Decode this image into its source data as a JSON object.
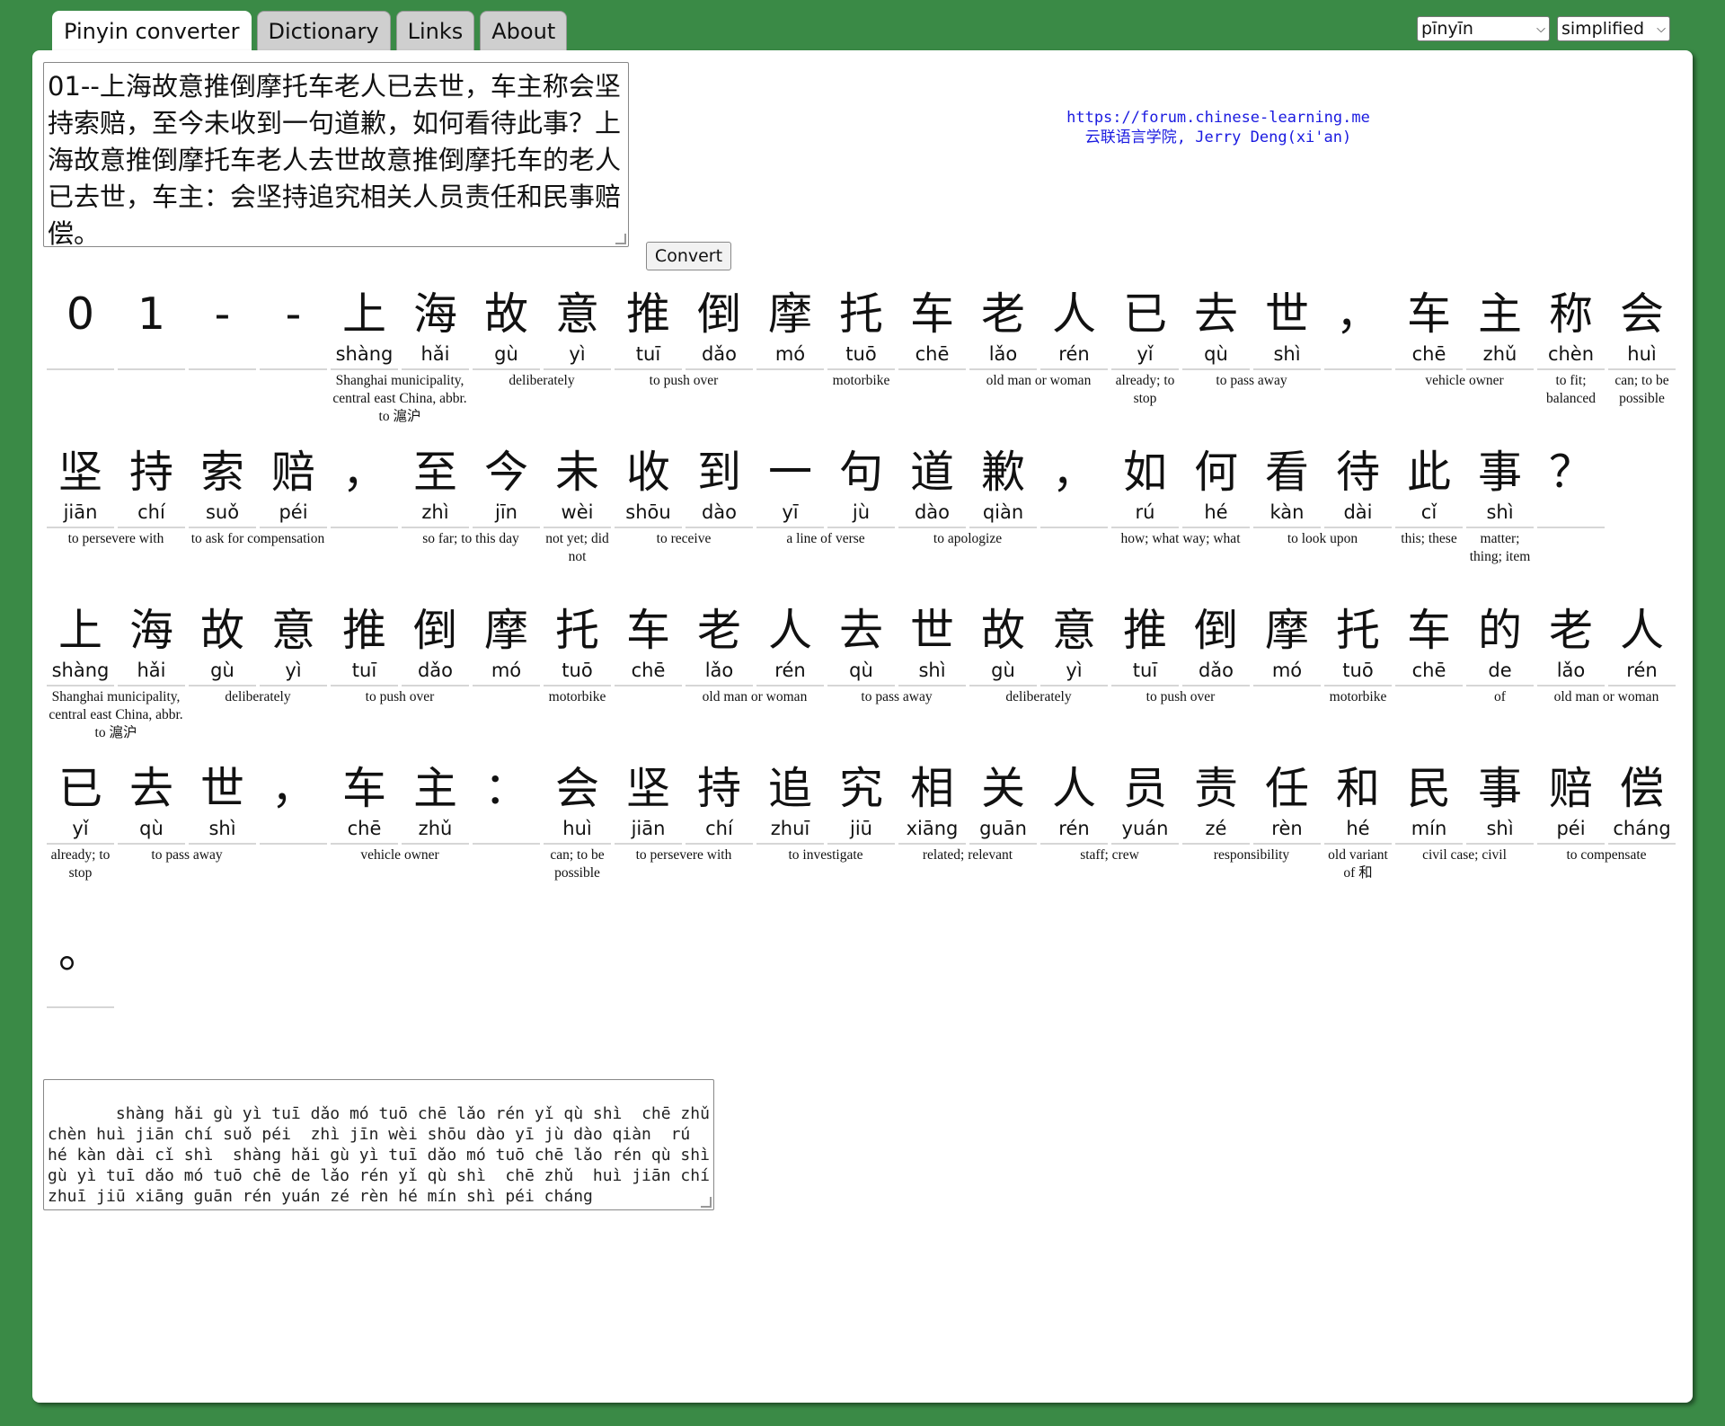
{
  "tabs": [
    "Pinyin converter",
    "Dictionary",
    "Links",
    "About"
  ],
  "selects": {
    "romanization": "pīnyīn",
    "script": "simplified"
  },
  "input_text": "01--上海故意推倒摩托车老人已去世，车主称会坚持索赔，至今未收到一句道歉，如何看待此事？上海故意推倒摩托车老人去世故意推倒摩托车的老人已去世，车主：会坚持追究相关人员责任和民事赔偿。",
  "convert_label": "Convert",
  "credit": {
    "line1": "https://forum.chinese-learning.me",
    "line2": "云联语言学院, Jerry Deng(xi'an)"
  },
  "lines": [
    {
      "chars": [
        {
          "h": "0",
          "p": ""
        },
        {
          "h": "1",
          "p": ""
        },
        {
          "h": "-",
          "p": ""
        },
        {
          "h": "-",
          "p": ""
        },
        {
          "h": "上",
          "p": "shàng"
        },
        {
          "h": "海",
          "p": "hǎi"
        },
        {
          "h": "故",
          "p": "gù"
        },
        {
          "h": "意",
          "p": "yì"
        },
        {
          "h": "推",
          "p": "tuī"
        },
        {
          "h": "倒",
          "p": "dǎo"
        },
        {
          "h": "摩",
          "p": "mó"
        },
        {
          "h": "托",
          "p": "tuō"
        },
        {
          "h": "车",
          "p": "chē"
        },
        {
          "h": "老",
          "p": "lǎo"
        },
        {
          "h": "人",
          "p": "rén"
        },
        {
          "h": "已",
          "p": "yǐ"
        },
        {
          "h": "去",
          "p": "qù"
        },
        {
          "h": "世",
          "p": "shì"
        },
        {
          "h": "，",
          "p": ""
        },
        {
          "h": "车",
          "p": "chē"
        },
        {
          "h": "主",
          "p": "zhǔ"
        },
        {
          "h": "称",
          "p": "chèn"
        },
        {
          "h": "会",
          "p": "huì"
        }
      ],
      "glosses": [
        {
          "start": 4,
          "span": 2,
          "text": "Shanghai municipality, central east China, abbr. to 滬沪"
        },
        {
          "start": 6,
          "span": 2,
          "text": "deliberately"
        },
        {
          "start": 8,
          "span": 2,
          "text": "to push over"
        },
        {
          "start": 10,
          "span": 3,
          "text": "motorbike"
        },
        {
          "start": 13,
          "span": 2,
          "text": "old man or woman"
        },
        {
          "start": 15,
          "span": 1,
          "text": "already; to stop"
        },
        {
          "start": 16,
          "span": 2,
          "text": "to pass away"
        },
        {
          "start": 19,
          "span": 2,
          "text": "vehicle owner"
        },
        {
          "start": 21,
          "span": 1,
          "text": "to fit; balanced"
        },
        {
          "start": 22,
          "span": 1,
          "text": "can; to be possible"
        }
      ]
    },
    {
      "chars": [
        {
          "h": "坚",
          "p": "jiān"
        },
        {
          "h": "持",
          "p": "chí"
        },
        {
          "h": "索",
          "p": "suǒ"
        },
        {
          "h": "赔",
          "p": "péi"
        },
        {
          "h": "，",
          "p": ""
        },
        {
          "h": "至",
          "p": "zhì"
        },
        {
          "h": "今",
          "p": "jīn"
        },
        {
          "h": "未",
          "p": "wèi"
        },
        {
          "h": "收",
          "p": "shōu"
        },
        {
          "h": "到",
          "p": "dào"
        },
        {
          "h": "一",
          "p": "yī"
        },
        {
          "h": "句",
          "p": "jù"
        },
        {
          "h": "道",
          "p": "dào"
        },
        {
          "h": "歉",
          "p": "qiàn"
        },
        {
          "h": "，",
          "p": ""
        },
        {
          "h": "如",
          "p": "rú"
        },
        {
          "h": "何",
          "p": "hé"
        },
        {
          "h": "看",
          "p": "kàn"
        },
        {
          "h": "待",
          "p": "dài"
        },
        {
          "h": "此",
          "p": "cǐ"
        },
        {
          "h": "事",
          "p": "shì"
        },
        {
          "h": "？",
          "p": ""
        }
      ],
      "glosses": [
        {
          "start": 0,
          "span": 2,
          "text": "to persevere with"
        },
        {
          "start": 2,
          "span": 2,
          "text": "to ask for compensation"
        },
        {
          "start": 5,
          "span": 2,
          "text": "so far; to this day"
        },
        {
          "start": 7,
          "span": 1,
          "text": "not yet; did not"
        },
        {
          "start": 8,
          "span": 2,
          "text": "to receive"
        },
        {
          "start": 10,
          "span": 2,
          "text": "a line of verse"
        },
        {
          "start": 12,
          "span": 2,
          "text": "to apologize"
        },
        {
          "start": 15,
          "span": 2,
          "text": "how; what way; what"
        },
        {
          "start": 17,
          "span": 2,
          "text": "to look upon"
        },
        {
          "start": 19,
          "span": 1,
          "text": "this; these"
        },
        {
          "start": 20,
          "span": 1,
          "text": "matter; thing; item"
        }
      ]
    },
    {
      "chars": [
        {
          "h": "上",
          "p": "shàng"
        },
        {
          "h": "海",
          "p": "hǎi"
        },
        {
          "h": "故",
          "p": "gù"
        },
        {
          "h": "意",
          "p": "yì"
        },
        {
          "h": "推",
          "p": "tuī"
        },
        {
          "h": "倒",
          "p": "dǎo"
        },
        {
          "h": "摩",
          "p": "mó"
        },
        {
          "h": "托",
          "p": "tuō"
        },
        {
          "h": "车",
          "p": "chē"
        },
        {
          "h": "老",
          "p": "lǎo"
        },
        {
          "h": "人",
          "p": "rén"
        },
        {
          "h": "去",
          "p": "qù"
        },
        {
          "h": "世",
          "p": "shì"
        },
        {
          "h": "故",
          "p": "gù"
        },
        {
          "h": "意",
          "p": "yì"
        },
        {
          "h": "推",
          "p": "tuī"
        },
        {
          "h": "倒",
          "p": "dǎo"
        },
        {
          "h": "摩",
          "p": "mó"
        },
        {
          "h": "托",
          "p": "tuō"
        },
        {
          "h": "车",
          "p": "chē"
        },
        {
          "h": "的",
          "p": "de"
        },
        {
          "h": "老",
          "p": "lǎo"
        },
        {
          "h": "人",
          "p": "rén"
        }
      ],
      "glosses": [
        {
          "start": 0,
          "span": 2,
          "text": "Shanghai municipality, central east China, abbr. to 滬沪"
        },
        {
          "start": 2,
          "span": 2,
          "text": "deliberately"
        },
        {
          "start": 4,
          "span": 2,
          "text": "to push over"
        },
        {
          "start": 6,
          "span": 3,
          "text": "motorbike"
        },
        {
          "start": 9,
          "span": 2,
          "text": "old man or woman"
        },
        {
          "start": 11,
          "span": 2,
          "text": "to pass away"
        },
        {
          "start": 13,
          "span": 2,
          "text": "deliberately"
        },
        {
          "start": 15,
          "span": 2,
          "text": "to push over"
        },
        {
          "start": 17,
          "span": 3,
          "text": "motorbike"
        },
        {
          "start": 20,
          "span": 1,
          "text": "of"
        },
        {
          "start": 21,
          "span": 2,
          "text": "old man or woman"
        }
      ]
    },
    {
      "chars": [
        {
          "h": "已",
          "p": "yǐ"
        },
        {
          "h": "去",
          "p": "qù"
        },
        {
          "h": "世",
          "p": "shì"
        },
        {
          "h": "，",
          "p": ""
        },
        {
          "h": "车",
          "p": "chē"
        },
        {
          "h": "主",
          "p": "zhǔ"
        },
        {
          "h": "：",
          "p": ""
        },
        {
          "h": "会",
          "p": "huì"
        },
        {
          "h": "坚",
          "p": "jiān"
        },
        {
          "h": "持",
          "p": "chí"
        },
        {
          "h": "追",
          "p": "zhuī"
        },
        {
          "h": "究",
          "p": "jiū"
        },
        {
          "h": "相",
          "p": "xiāng"
        },
        {
          "h": "关",
          "p": "guān"
        },
        {
          "h": "人",
          "p": "rén"
        },
        {
          "h": "员",
          "p": "yuán"
        },
        {
          "h": "责",
          "p": "zé"
        },
        {
          "h": "任",
          "p": "rèn"
        },
        {
          "h": "和",
          "p": "hé"
        },
        {
          "h": "民",
          "p": "mín"
        },
        {
          "h": "事",
          "p": "shì"
        },
        {
          "h": "赔",
          "p": "péi"
        },
        {
          "h": "偿",
          "p": "cháng"
        }
      ],
      "glosses": [
        {
          "start": 0,
          "span": 1,
          "text": "already; to stop"
        },
        {
          "start": 1,
          "span": 2,
          "text": "to pass away"
        },
        {
          "start": 4,
          "span": 2,
          "text": "vehicle owner"
        },
        {
          "start": 7,
          "span": 1,
          "text": "can; to be possible"
        },
        {
          "start": 8,
          "span": 2,
          "text": "to persevere with"
        },
        {
          "start": 10,
          "span": 2,
          "text": "to investigate"
        },
        {
          "start": 12,
          "span": 2,
          "text": "related; relevant"
        },
        {
          "start": 14,
          "span": 2,
          "text": "staff; crew"
        },
        {
          "start": 16,
          "span": 2,
          "text": "responsibility"
        },
        {
          "start": 18,
          "span": 1,
          "text": "old variant of 和"
        },
        {
          "start": 19,
          "span": 2,
          "text": "civil case; civil"
        },
        {
          "start": 21,
          "span": 2,
          "text": "to compensate"
        }
      ]
    },
    {
      "chars": [
        {
          "h": "。",
          "p": ""
        }
      ],
      "glosses": []
    }
  ],
  "output_text": "   shàng hǎi gù yì tuī dǎo mó tuō chē lǎo rén yǐ qù shì  chē zhǔ chèn huì jiān chí suǒ péi  zhì jīn wèi shōu dào yī jù dào qiàn  rú hé kàn dài cǐ shì  shàng hǎi gù yì tuī dǎo mó tuō chē lǎo rén qù shì gù yì tuī dǎo mó tuō chē de lǎo rén yǐ qù shì  chē zhǔ  huì jiān chí zhuī jiū xiāng guān rén yuán zé rèn hé mín shì péi cháng"
}
